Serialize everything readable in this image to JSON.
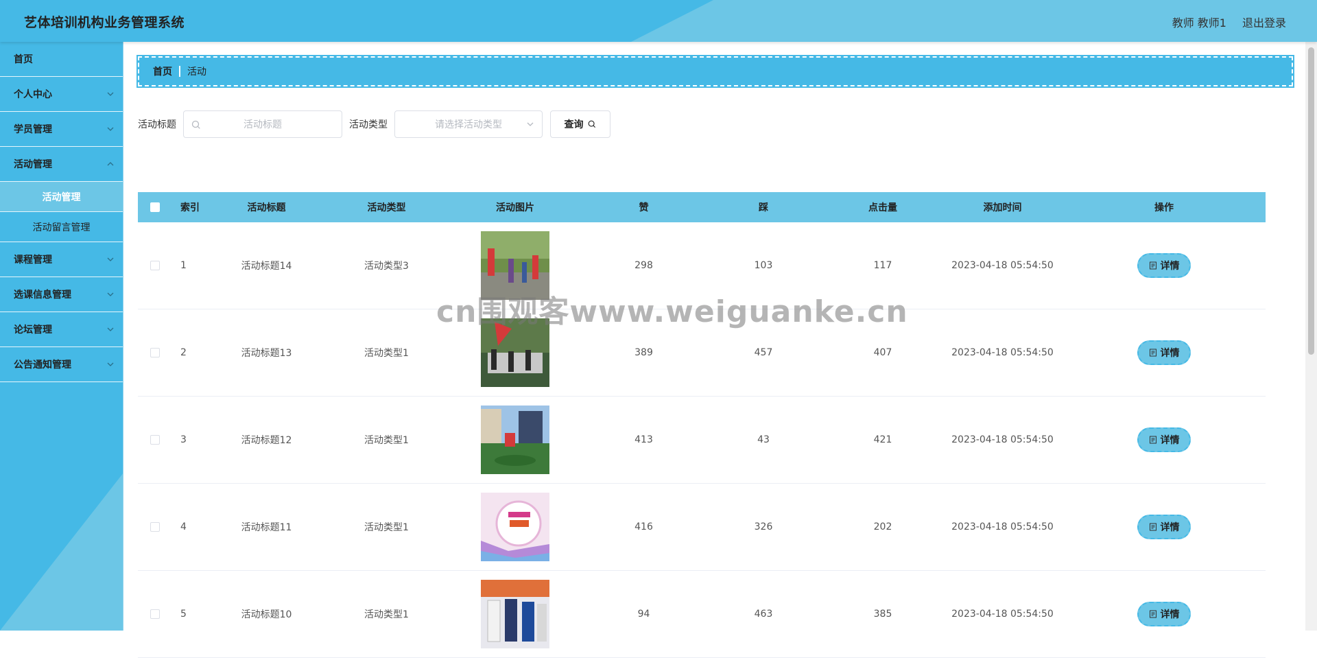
{
  "header": {
    "title": "艺体培训机构业务管理系统",
    "user": "教师 教师1",
    "logout": "退出登录"
  },
  "sidebar": {
    "items": [
      {
        "label": "首页",
        "has_arrow": false
      },
      {
        "label": "个人中心",
        "has_arrow": true
      },
      {
        "label": "学员管理",
        "has_arrow": true
      },
      {
        "label": "活动管理",
        "has_arrow": true
      }
    ],
    "sub_items": [
      {
        "label": "活动管理",
        "active": true
      },
      {
        "label": "活动留言管理",
        "active": false
      }
    ],
    "items_after": [
      {
        "label": "课程管理"
      },
      {
        "label": "选课信息管理"
      },
      {
        "label": "论坛管理"
      },
      {
        "label": "公告通知管理"
      }
    ]
  },
  "breadcrumb": {
    "home": "首页",
    "current": "活动"
  },
  "search": {
    "title_label": "活动标题",
    "title_placeholder": "活动标题",
    "type_label": "活动类型",
    "type_placeholder": "请选择活动类型",
    "query_button": "查询"
  },
  "table": {
    "headers": [
      "索引",
      "活动标题",
      "活动类型",
      "活动图片",
      "赞",
      "踩",
      "点击量",
      "添加时间",
      "操作"
    ],
    "detail_label": "详情",
    "rows": [
      {
        "index": "1",
        "title": "活动标题14",
        "type": "活动类型3",
        "likes": "298",
        "dislikes": "103",
        "clicks": "117",
        "time": "2023-04-18 05:54:50"
      },
      {
        "index": "2",
        "title": "活动标题13",
        "type": "活动类型1",
        "likes": "389",
        "dislikes": "457",
        "clicks": "407",
        "time": "2023-04-18 05:54:50"
      },
      {
        "index": "3",
        "title": "活动标题12",
        "type": "活动类型1",
        "likes": "413",
        "dislikes": "43",
        "clicks": "421",
        "time": "2023-04-18 05:54:50"
      },
      {
        "index": "4",
        "title": "活动标题11",
        "type": "活动类型1",
        "likes": "416",
        "dislikes": "326",
        "clicks": "202",
        "time": "2023-04-18 05:54:50"
      },
      {
        "index": "5",
        "title": "活动标题10",
        "type": "活动类型1",
        "likes": "94",
        "dislikes": "463",
        "clicks": "385",
        "time": "2023-04-18 05:54:50"
      }
    ]
  },
  "watermark": "cn围观客www.weiguanke.cn",
  "colors": {
    "primary": "#45b9e6",
    "light": "#6cc6e6"
  }
}
